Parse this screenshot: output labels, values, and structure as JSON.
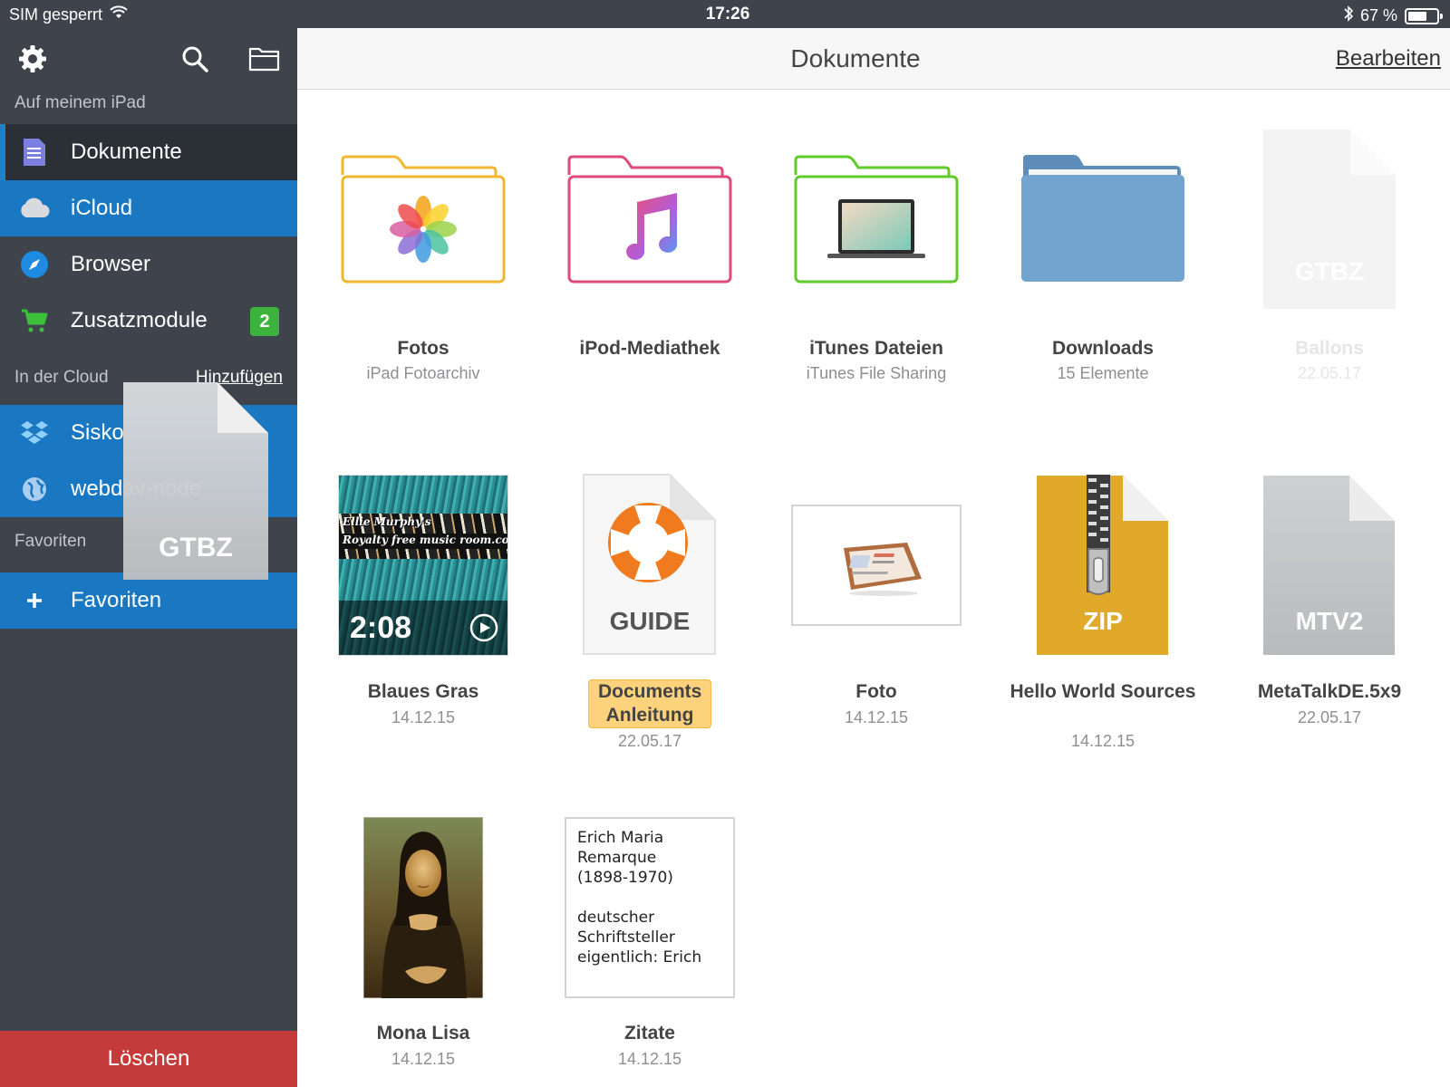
{
  "status_bar": {
    "carrier": "SIM gesperrt",
    "time": "17:26",
    "battery_text": "67 %",
    "battery_level": 0.67
  },
  "sidebar": {
    "section_ipad": "Auf meinem iPad",
    "items_ipad": [
      {
        "label": "Dokumente",
        "icon": "document-icon"
      },
      {
        "label": "iCloud",
        "icon": "cloud-icon"
      },
      {
        "label": "Browser",
        "icon": "compass-icon"
      },
      {
        "label": "Zusatzmodule",
        "icon": "cart-icon",
        "badge": "2"
      }
    ],
    "section_cloud": "In der Cloud",
    "cloud_add": "Hinzufügen",
    "items_cloud": [
      {
        "label": "Sisko",
        "icon": "dropbox-icon"
      },
      {
        "label": "webdav-node",
        "icon": "globe-icon"
      }
    ],
    "section_favorites": "Favoriten",
    "items_favorites": [
      {
        "label": "Favoriten",
        "icon": "plus-icon"
      }
    ],
    "delete_label": "Löschen",
    "drag_ghost_label": "GTBZ"
  },
  "header": {
    "title": "Dokumente",
    "edit_label": "Bearbeiten"
  },
  "files": [
    {
      "name": "Fotos",
      "sub": "iPad Fotoarchiv",
      "type": "folder",
      "color": "#f2b731"
    },
    {
      "name": "iPod-Mediathek",
      "sub": "",
      "type": "folder",
      "color": "#e04a78"
    },
    {
      "name": "iTunes Dateien",
      "sub": "iTunes File Sharing",
      "type": "folder",
      "color": "#5ecb2a"
    },
    {
      "name": "Downloads",
      "sub": "15 Elemente",
      "type": "folder",
      "color": "#6f9ec7"
    },
    {
      "name": "Ballons",
      "sub": "22.05.17",
      "type": "file",
      "label": "GTBZ"
    },
    {
      "name": "Blaues Gras",
      "sub": "14.12.15",
      "type": "video",
      "duration": "2:08",
      "overlay_line1": "Ellie Murphy's",
      "overlay_line2": "Royalty free music room.com"
    },
    {
      "name": "Documents Anleitung",
      "sub": "22.05.17",
      "type": "file",
      "label": "GUIDE"
    },
    {
      "name": "Foto",
      "sub": "14.12.15",
      "type": "image"
    },
    {
      "name": "Hello World Sources",
      "sub": "14.12.15",
      "type": "file",
      "label": "ZIP"
    },
    {
      "name": "MetaTalkDE.5x9",
      "sub": "22.05.17",
      "type": "file",
      "label": "MTV2"
    },
    {
      "name": "Mona Lisa",
      "sub": "14.12.15",
      "type": "image"
    },
    {
      "name": "Zitate",
      "sub": "14.12.15",
      "type": "text",
      "preview": "Erich Maria\nRemarque\n(1898-1970)\n\ndeutscher\nSchriftsteller\neigentlich: Erich"
    }
  ]
}
